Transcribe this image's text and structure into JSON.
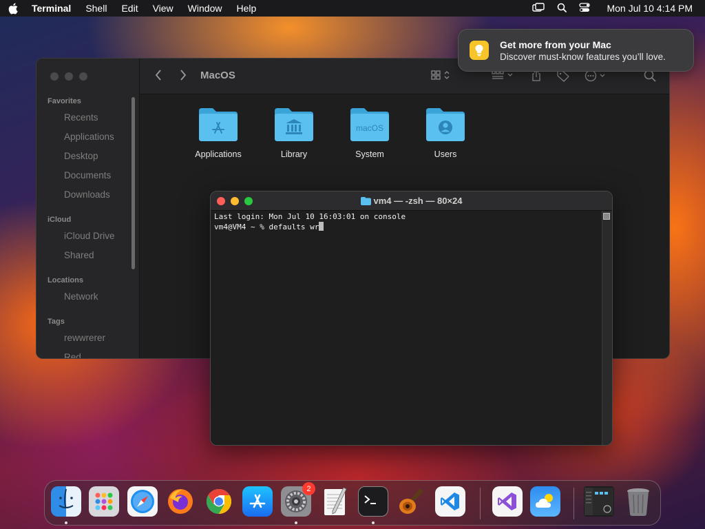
{
  "menubar": {
    "app_name": "Terminal",
    "menus": [
      "Shell",
      "Edit",
      "View",
      "Window",
      "Help"
    ],
    "clock": "Mon Jul 10  4:14 PM"
  },
  "notification": {
    "title": "Get more from your Mac",
    "body": "Discover must-know features you’ll love."
  },
  "finder": {
    "title": "MacOS",
    "sidebar": {
      "sections": [
        {
          "title": "Favorites",
          "items": [
            "Recents",
            "Applications",
            "Desktop",
            "Documents",
            "Downloads"
          ]
        },
        {
          "title": "iCloud",
          "items": [
            "iCloud Drive",
            "Shared"
          ]
        },
        {
          "title": "Locations",
          "items": [
            "Network"
          ]
        },
        {
          "title": "Tags",
          "items": [
            "rewwrerer",
            "Red"
          ]
        }
      ]
    },
    "folders": [
      {
        "label": "Applications",
        "glyph": "app-store-icon"
      },
      {
        "label": "Library",
        "glyph": "library-icon"
      },
      {
        "label": "System",
        "glyph": "macos-text",
        "text": "macOS"
      },
      {
        "label": "Users",
        "glyph": "user-icon"
      }
    ]
  },
  "terminal": {
    "title": "vm4 — -zsh — 80×24",
    "lines": [
      "Last login: Mon Jul 10 16:03:01 on console",
      "vm4@VM4 ~ % defaults wr"
    ]
  },
  "dock": {
    "apps": [
      {
        "name": "Finder",
        "icon": "finder-icon",
        "running": true
      },
      {
        "name": "Launchpad",
        "icon": "launchpad-icon",
        "running": false
      },
      {
        "name": "Safari",
        "icon": "safari-icon",
        "running": false
      },
      {
        "name": "Firefox",
        "icon": "firefox-icon",
        "running": false
      },
      {
        "name": "Chrome",
        "icon": "chrome-icon",
        "running": false
      },
      {
        "name": "App Store",
        "icon": "app-store-icon",
        "running": false
      },
      {
        "name": "System Settings",
        "icon": "gear-icon",
        "running": true,
        "badge": "2"
      },
      {
        "name": "TextEdit",
        "icon": "textedit-icon",
        "running": false
      },
      {
        "name": "Terminal",
        "icon": "terminal-icon",
        "running": true
      },
      {
        "name": "GarageBand",
        "icon": "guitar-icon",
        "running": false
      },
      {
        "name": "Visual Studio Code",
        "icon": "vscode-icon",
        "running": false
      },
      {
        "name": "Visual Studio",
        "icon": "visual-studio-icon",
        "running": false
      },
      {
        "name": "Weather",
        "icon": "weather-icon",
        "running": false
      },
      {
        "name": "Recent Window",
        "icon": "window-thumbnail-icon",
        "running": false
      },
      {
        "name": "Trash",
        "icon": "trash-icon",
        "running": false
      }
    ]
  },
  "colors": {
    "folder_blue": "#5ac0f0",
    "close": "#ff5f57",
    "minimize": "#febc2e",
    "zoom": "#28c840",
    "badge": "#ff3b30"
  }
}
